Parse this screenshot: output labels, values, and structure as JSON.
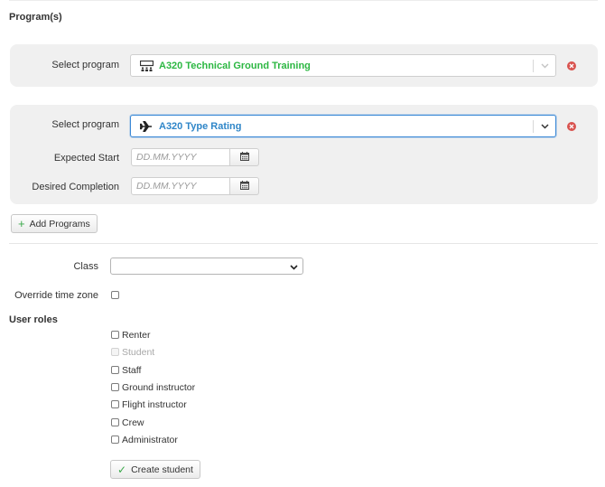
{
  "section_title": "Program(s)",
  "programs": [
    {
      "select_label": "Select program",
      "selected": "A320 Technical Ground Training",
      "icon": "classroom-icon",
      "text_color": "#2cb742"
    },
    {
      "select_label": "Select program",
      "selected": "A320 Type Rating",
      "icon": "airplane-icon",
      "text_color": "#2f86c8",
      "expected_start_label": "Expected Start",
      "expected_start_placeholder": "DD.MM.YYYY",
      "desired_completion_label": "Desired Completion",
      "desired_completion_placeholder": "DD.MM.YYYY"
    }
  ],
  "add_programs_label": "Add Programs",
  "class_label": "Class",
  "class_value": "",
  "override_tz_label": "Override time zone",
  "user_roles_title": "User roles",
  "roles": [
    {
      "label": "Renter",
      "checked": false,
      "disabled": false
    },
    {
      "label": "Student",
      "checked": false,
      "disabled": true
    },
    {
      "label": "Staff",
      "checked": false,
      "disabled": false
    },
    {
      "label": "Ground instructor",
      "checked": false,
      "disabled": false
    },
    {
      "label": "Flight instructor",
      "checked": false,
      "disabled": false
    },
    {
      "label": "Crew",
      "checked": false,
      "disabled": false
    },
    {
      "label": "Administrator",
      "checked": false,
      "disabled": false
    }
  ],
  "create_button_label": "Create student",
  "colors": {
    "panel_bg": "#f0f0f0",
    "focus_border": "#3b89d6",
    "remove_red": "#d9534f",
    "check_green": "#3aa84a"
  }
}
